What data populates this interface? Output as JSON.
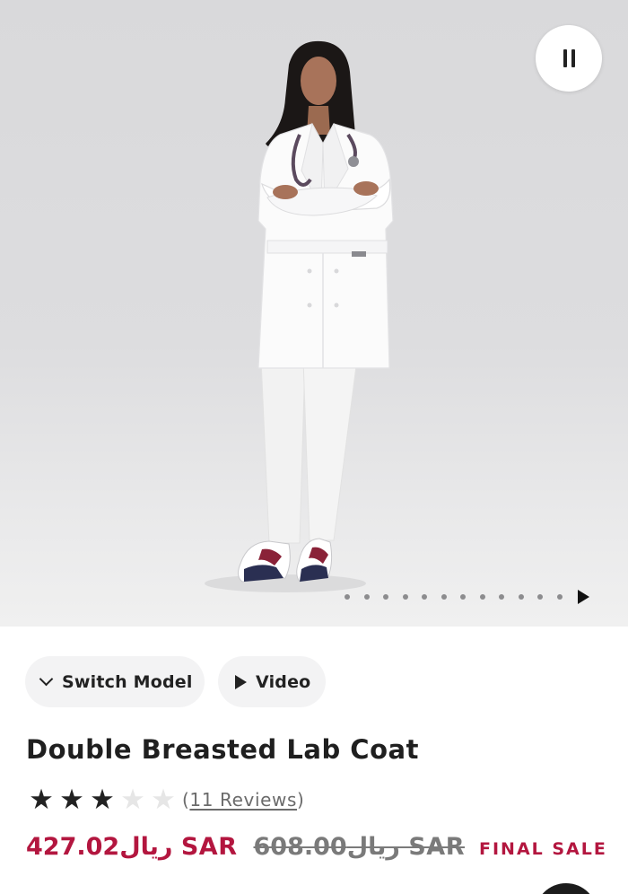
{
  "hero": {
    "image_description": "",
    "pause_icon": "pause-icon",
    "carousel": {
      "dot_count": 12,
      "next_icon": "play-icon"
    }
  },
  "actions": {
    "switch_model_label": "Switch Model",
    "switch_model_icon": "chevron-down-icon",
    "video_label": "Video",
    "video_icon": "play-icon"
  },
  "product": {
    "title": "Double Breasted Lab Coat",
    "rating": {
      "value": 3,
      "max": 5
    },
    "reviews_open": "(",
    "reviews_link": "11 Reviews",
    "reviews_close": ")",
    "price_current": "427.02ريال SAR",
    "price_original": "608.00ريال SAR",
    "sale_badge": "FINAL SALE"
  },
  "colors": {
    "sale_accent": "#b3163f",
    "text_primary": "#1f1f1f",
    "pill_background": "#f3f3f4"
  }
}
